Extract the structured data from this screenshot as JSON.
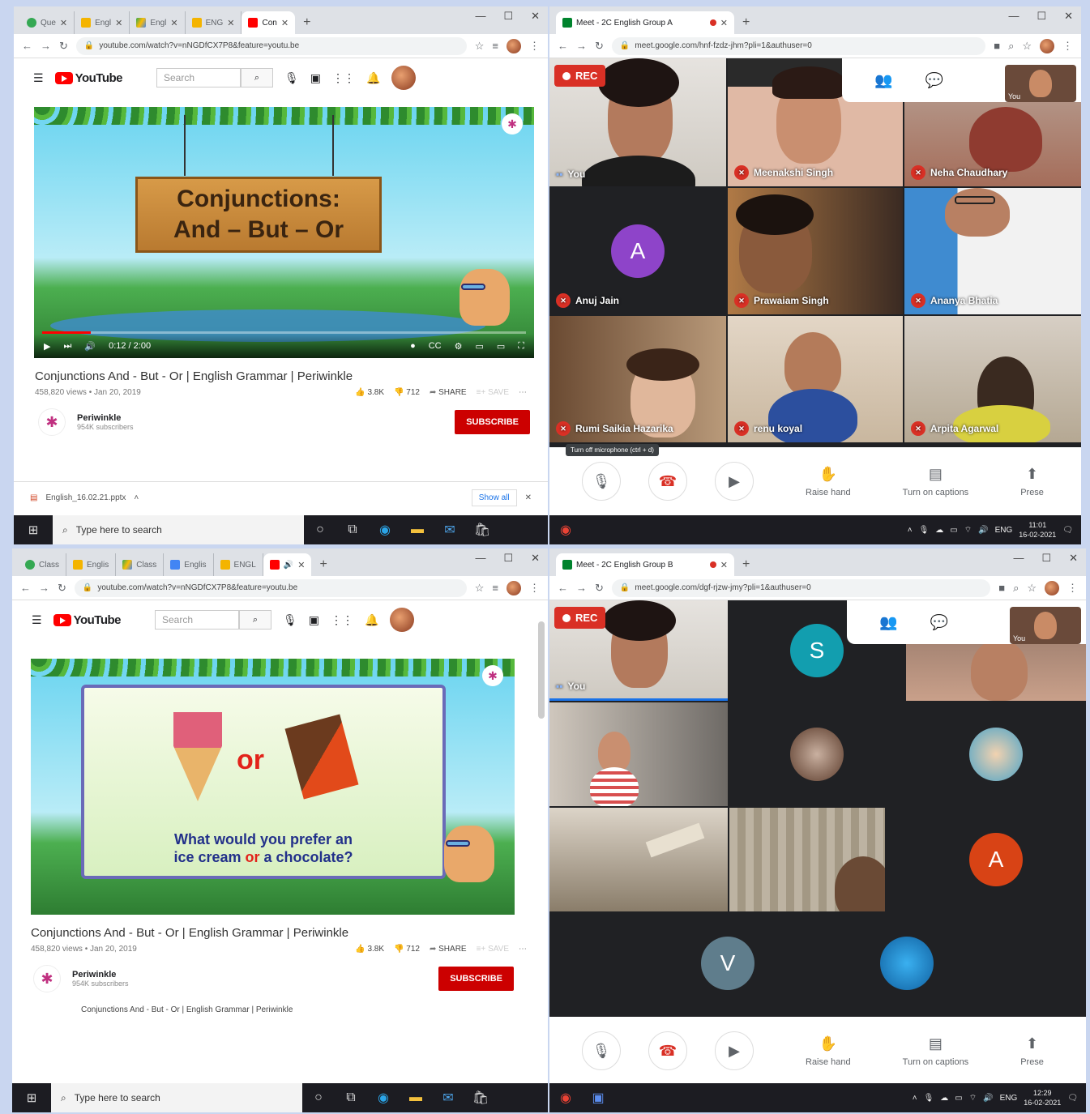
{
  "top_browser": {
    "tabs": [
      {
        "label": "Que",
        "icon": "chrome-tab-favicon"
      },
      {
        "label": "Engl",
        "icon": "slides-favicon"
      },
      {
        "label": "Engl",
        "icon": "drive-favicon"
      },
      {
        "label": "ENG",
        "icon": "slides-favicon"
      },
      {
        "label": "Con",
        "icon": "youtube-favicon"
      }
    ],
    "url": "youtube.com/watch?v=nNGDfCX7P8&feature=youtu.be",
    "yt_logo": "YouTube",
    "search_placeholder": "Search",
    "video": {
      "sign_line1": "Conjunctions:",
      "sign_line2": "And – But – Or",
      "time": "0:12 / 2:00",
      "progress": 0.1
    },
    "title": "Conjunctions And - But - Or | English Grammar | Periwinkle",
    "views": "458,820 views • Jan 20, 2019",
    "likes": "3.8K",
    "dislikes": "712",
    "share": "SHARE",
    "save": "SAVE",
    "channel": "Periwinkle",
    "subscribers": "954K subscribers",
    "subscribe": "SUBSCRIBE",
    "download": "English_16.02.21.pptx",
    "show_all": "Show all",
    "taskbar_search": "Type here to search"
  },
  "top_meet": {
    "tab": "Meet - 2C English Group A",
    "url": "meet.google.com/hnf-fzdz-jhm?pli=1&authuser=0",
    "rec": "REC",
    "self_label": "You",
    "participants": [
      {
        "name": "You",
        "muted": false
      },
      {
        "name": "Meenakshi Singh",
        "muted": true
      },
      {
        "name": "Neha Chaudhary",
        "muted": true
      },
      {
        "name": "Anuj Jain",
        "muted": true,
        "initial": "A",
        "color": "#8e44c9"
      },
      {
        "name": "Prawaiam Singh",
        "muted": true
      },
      {
        "name": "Ananya Bhatia",
        "muted": true
      },
      {
        "name": "Rumi Saikia Hazarika",
        "muted": true
      },
      {
        "name": "renu koyal",
        "muted": true
      },
      {
        "name": "Arpita Agarwal",
        "muted": true
      }
    ],
    "tooltip": "Turn off microphone (ctrl + d)",
    "raise_hand": "Raise hand",
    "captions": "Turn on captions",
    "present": "Prese",
    "lang": "ENG",
    "time": "11:01",
    "date": "16-02-2021"
  },
  "bottom_browser": {
    "tabs": [
      {
        "label": "Class",
        "icon": "chrome-tab-favicon"
      },
      {
        "label": "Englis",
        "icon": "slides-favicon"
      },
      {
        "label": "Class",
        "icon": "drive-favicon"
      },
      {
        "label": "Englis",
        "icon": "docs-favicon"
      },
      {
        "label": "ENGL",
        "icon": "slides-favicon"
      }
    ],
    "url": "youtube.com/watch?v=nNGDfCX7P8&feature=youtu.be",
    "yt_logo": "YouTube",
    "search_placeholder": "Search",
    "video": {
      "or_word": "or",
      "question_line1": "What would you prefer an",
      "question_line2a": "ice cream ",
      "question_line2b": "or",
      "question_line2c": " a chocolate?"
    },
    "title": "Conjunctions And - But - Or | English Grammar | Periwinkle",
    "views": "458,820 views • Jan 20, 2019",
    "likes": "3.8K",
    "dislikes": "712",
    "share": "SHARE",
    "save": "SAVE",
    "channel": "Periwinkle",
    "subscribers": "954K subscribers",
    "subscribe": "SUBSCRIBE",
    "description": "Conjunctions And - But - Or | English Grammar | Periwinkle",
    "taskbar_search": "Type here to search"
  },
  "bottom_meet": {
    "tab": "Meet - 2C English Group B",
    "url": "meet.google.com/dgf-rjzw-jmy?pli=1&authuser=0",
    "rec": "REC",
    "self_label": "You",
    "initials": [
      {
        "letter": "S",
        "color": "#129eaf"
      },
      {
        "letter": "A",
        "color": "#d84315"
      },
      {
        "letter": "V",
        "color": "#5f7d8c"
      }
    ],
    "raise_hand": "Raise hand",
    "captions": "Turn on captions",
    "present": "Prese",
    "lang": "ENG",
    "time": "12:29",
    "date": "16-02-2021"
  }
}
